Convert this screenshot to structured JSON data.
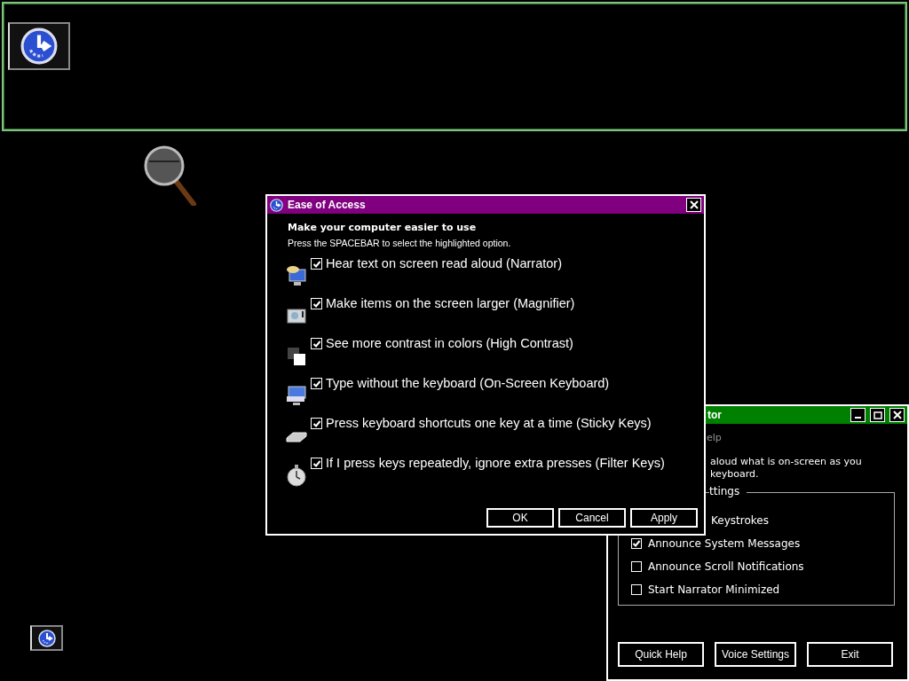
{
  "dialog": {
    "title": "Ease of Access",
    "heading": "Make your computer easier to use",
    "hint": "Press the SPACEBAR to select the highlighted option.",
    "options": [
      {
        "kind": "narrator",
        "label": "Hear text on screen read aloud (Narrator)",
        "checked": true
      },
      {
        "kind": "magnifier",
        "label": "Make items on the screen larger (Magnifier)",
        "checked": true
      },
      {
        "kind": "contrast",
        "label": "See more contrast in colors (High Contrast)",
        "checked": true
      },
      {
        "kind": "keyboard",
        "label": "Type without the keyboard (On-Screen Keyboard)",
        "checked": true
      },
      {
        "kind": "sticky",
        "label": "Press keyboard shortcuts one key at a time (Sticky Keys)",
        "checked": true
      },
      {
        "kind": "filter",
        "label": "If I press keys repeatedly, ignore extra presses (Filter Keys)",
        "checked": true
      }
    ],
    "buttons": [
      "OK",
      "Cancel",
      "Apply"
    ]
  },
  "narrator": {
    "title": "tor",
    "menu": "elp",
    "description": [
      "aloud what is on-screen as you",
      "keyboard."
    ],
    "group_legend": "ttings",
    "partial_item": "Keystrokes",
    "items": [
      {
        "label": "Announce System Messages",
        "checked": true
      },
      {
        "label": "Announce Scroll Notifications",
        "checked": false
      },
      {
        "label": "Start Narrator Minimized",
        "checked": false
      }
    ],
    "buttons": [
      "Quick Help",
      "Voice Settings",
      "Exit"
    ]
  }
}
